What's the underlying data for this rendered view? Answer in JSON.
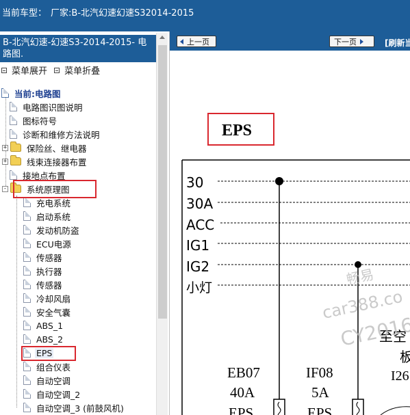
{
  "topbar": {
    "label": "当前车型：",
    "value": "厂家:B-北汽幻速幻速S32014-2015"
  },
  "sidebar": {
    "header": "B-北汽幻速-幻速S3-2014-2015- 电路图.",
    "expand_all": "菜单展开",
    "collapse_all": "菜单折叠",
    "root": "当前:电路图",
    "items": [
      {
        "label": "电路图识图说明"
      },
      {
        "label": "图标符号"
      },
      {
        "label": "诊断和维修方法说明"
      },
      {
        "label": "保险丝、继电器"
      },
      {
        "label": "线束连接器布置"
      },
      {
        "label": "接地点布置"
      },
      {
        "label": "系统原理图"
      }
    ],
    "children": [
      {
        "label": "充电系统"
      },
      {
        "label": "启动系统"
      },
      {
        "label": "发动机防盗"
      },
      {
        "label": "ECU电源"
      },
      {
        "label": "传感器"
      },
      {
        "label": "执行器"
      },
      {
        "label": "传感器"
      },
      {
        "label": "冷却风扇"
      },
      {
        "label": "安全气囊"
      },
      {
        "label": "ABS_1"
      },
      {
        "label": "ABS_2"
      },
      {
        "label": "EPS"
      },
      {
        "label": "组合仪表"
      },
      {
        "label": "自动空调"
      },
      {
        "label": "自动空调_2"
      },
      {
        "label": "自动空调_3 (前鼓风机)"
      }
    ]
  },
  "nav": {
    "prev": "上一页",
    "next": "下一页",
    "refresh": "[刷新当"
  },
  "diagram": {
    "title": "EPS",
    "terminals": [
      "30",
      "30A",
      "ACC",
      "IG1",
      "IG2",
      "小灯"
    ],
    "fuses": [
      {
        "id": "EB07",
        "rating": "40A",
        "name": "EPS"
      },
      {
        "id": "IF08",
        "rating": "5A",
        "name": "EPS"
      }
    ],
    "partial_label_1": "至空",
    "partial_label_2": "板",
    "partial_label_3": "I26",
    "watermark": [
      "畅易",
      "car388.co",
      "CY2016"
    ]
  },
  "colors": {
    "header_bg": "#1d5d98",
    "highlight_red": "#d9272e"
  }
}
